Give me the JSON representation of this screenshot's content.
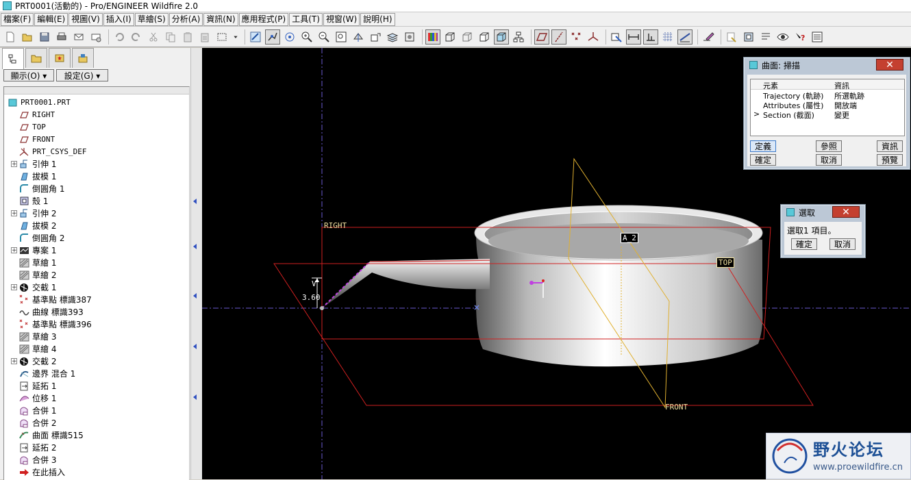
{
  "window": {
    "title": "PRT0001(活動的) - Pro/ENGINEER Wildfire 2.0"
  },
  "menu": [
    "檔案(F)",
    "編輯(E)",
    "視圖(V)",
    "插入(I)",
    "草繪(S)",
    "分析(A)",
    "資訊(N)",
    "應用程式(P)",
    "工具(T)",
    "視窗(W)",
    "說明(H)"
  ],
  "toolbar": {
    "icons": [
      "new-icon",
      "open-icon",
      "save-icon",
      "print-icon",
      "email-icon",
      "email-link-icon",
      "undo-icon",
      "redo-icon",
      "cut-icon",
      "copy-icon",
      "paste-icon",
      "paste-special-icon",
      "select-box-icon",
      "dropdown-icon",
      "regenerate-icon",
      "spin-center-icon",
      "orient-icon",
      "zoom-in-icon",
      "zoom-out-icon",
      "refit-icon",
      "view-manager-icon",
      "saved-views-icon",
      "layers-icon",
      "appearance-icon",
      "color-palette-icon",
      "wireframe-icon",
      "hidden-line-icon",
      "no-hidden-icon",
      "shading-icon",
      "model-tree-icon",
      "datum-plane-icon",
      "datum-axis-icon",
      "datum-point-icon",
      "csys-icon",
      "annotation-icon",
      "dimension-icon",
      "offset-icon",
      "grid-icon",
      "analysis-icon",
      "sketch-icon",
      "copy-curve-icon",
      "mirror-icon",
      "repaint-icon",
      "eye-icon",
      "help-icon",
      "info-icon"
    ]
  },
  "leftPanel": {
    "tabs": [
      "model-tree-tab",
      "folder-tab",
      "favorites-tab",
      "connections-tab"
    ],
    "show_button": "顯示(O) ▾",
    "settings_button": "設定(G) ▾",
    "tree": [
      {
        "label": "PRT0001.PRT",
        "icon": "part-icon",
        "root": true,
        "expand": false
      },
      {
        "label": "RIGHT",
        "icon": "datum-plane-icon",
        "expand": false
      },
      {
        "label": "TOP",
        "icon": "datum-plane-icon",
        "expand": false
      },
      {
        "label": "FRONT",
        "icon": "datum-plane-icon",
        "expand": false
      },
      {
        "label": "PRT_CSYS_DEF",
        "icon": "csys-icon",
        "expand": false
      },
      {
        "label": "引伸 1",
        "icon": "extrude-icon",
        "expand": true
      },
      {
        "label": "拔模 1",
        "icon": "draft-icon",
        "expand": false
      },
      {
        "label": "倒圓角 1",
        "icon": "round-icon",
        "expand": false
      },
      {
        "label": "殼 1",
        "icon": "shell-icon",
        "expand": false
      },
      {
        "label": "引伸 2",
        "icon": "extrude-icon",
        "expand": true
      },
      {
        "label": "拔模 2",
        "icon": "draft-icon",
        "expand": false
      },
      {
        "label": "倒圓角 2",
        "icon": "round-icon",
        "expand": false
      },
      {
        "label": "專案 1",
        "icon": "project-icon",
        "expand": true
      },
      {
        "label": "草繪 1",
        "icon": "sketch-feature-icon",
        "expand": false
      },
      {
        "label": "草繪 2",
        "icon": "sketch-feature-icon",
        "expand": false
      },
      {
        "label": "交截 1",
        "icon": "intersect-icon",
        "expand": true
      },
      {
        "label": "基準點 標識387",
        "icon": "datum-point-icon",
        "expand": false
      },
      {
        "label": "曲線 標識393",
        "icon": "curve-icon",
        "expand": false
      },
      {
        "label": "基準點 標識396",
        "icon": "datum-point-icon",
        "expand": false
      },
      {
        "label": "草繪 3",
        "icon": "sketch-feature-icon",
        "expand": false
      },
      {
        "label": "草繪 4",
        "icon": "sketch-feature-icon",
        "expand": false
      },
      {
        "label": "交截 2",
        "icon": "intersect-icon",
        "expand": true
      },
      {
        "label": "邊界 混合 1",
        "icon": "boundary-blend-icon",
        "expand": false
      },
      {
        "label": "延拓 1",
        "icon": "extend-icon",
        "expand": false
      },
      {
        "label": "位移 1",
        "icon": "offset-icon",
        "expand": false
      },
      {
        "label": "合併 1",
        "icon": "merge-icon",
        "expand": false
      },
      {
        "label": "合併 2",
        "icon": "merge-icon",
        "expand": false
      },
      {
        "label": "曲面 標識515",
        "icon": "surface-icon",
        "expand": false
      },
      {
        "label": "延拓 2",
        "icon": "extend-icon",
        "expand": false
      },
      {
        "label": "合併 3",
        "icon": "merge-icon",
        "expand": false
      },
      {
        "label": "在此插入",
        "icon": "insert-here-icon",
        "expand": false
      }
    ]
  },
  "graphics": {
    "labels": {
      "right": "RIGHT",
      "top": "TOP",
      "front": "FRONT",
      "axis": "A_2",
      "dim_value": "3.60",
      "dim_letter": "V"
    }
  },
  "sweepDialog": {
    "title": "曲面: 掃描",
    "close": "✕",
    "header": {
      "element": "元素",
      "info": "資訊"
    },
    "rows": [
      {
        "marker": "",
        "element": "Trajectory (軌跡)",
        "info": "所選軌跡"
      },
      {
        "marker": "",
        "element": "Attributes (屬性)",
        "info": "開放端"
      },
      {
        "marker": ">",
        "element": "Section (截面)",
        "info": "變更"
      }
    ],
    "buttons": {
      "define": "定義",
      "refs": "參照",
      "info": "資訊",
      "ok": "確定",
      "cancel": "取消",
      "preview": "預覽"
    }
  },
  "selectDialog": {
    "title": "選取",
    "close": "✕",
    "message": "選取1 項目。",
    "buttons": {
      "ok": "確定",
      "cancel": "取消"
    }
  },
  "watermark": {
    "name": "野火论坛",
    "url": "www.proewildfire.cn"
  }
}
